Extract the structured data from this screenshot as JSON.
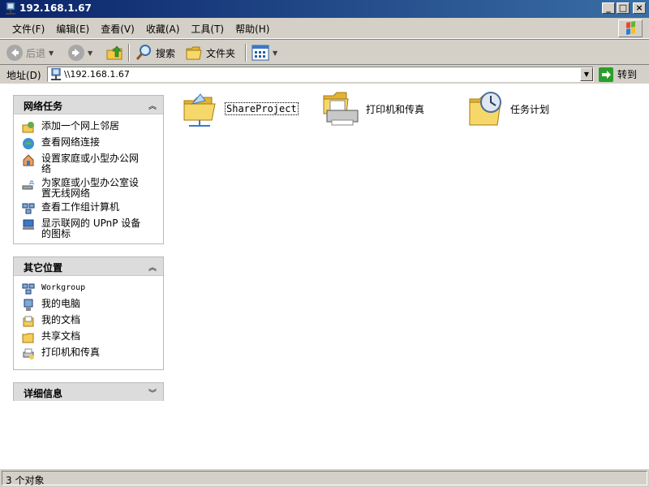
{
  "window": {
    "title": "192.168.1.67",
    "icon": "network-computer-icon"
  },
  "menu": {
    "items": [
      "文件(F)",
      "编辑(E)",
      "查看(V)",
      "收藏(A)",
      "工具(T)",
      "帮助(H)"
    ]
  },
  "toolbar": {
    "back_label": "后退",
    "search_label": "搜索",
    "folders_label": "文件夹"
  },
  "address": {
    "label": "地址(D)",
    "value": "\\\\192.168.1.67",
    "go_label": "转到"
  },
  "panels": {
    "network_tasks": {
      "title": "网络任务",
      "items": [
        {
          "label": "添加一个网上邻居",
          "icon": "add-network-place-icon"
        },
        {
          "label": "查看网络连接",
          "icon": "network-connections-icon"
        },
        {
          "label": "设置家庭或小型办公网络",
          "icon": "home-network-icon"
        },
        {
          "label": "为家庭或小型办公室设置无线网络",
          "icon": "wireless-network-icon"
        },
        {
          "label": "查看工作组计算机",
          "icon": "workgroup-computers-icon"
        },
        {
          "label": "显示联网的 UPnP 设备的图标",
          "icon": "upnp-device-icon"
        }
      ]
    },
    "other_places": {
      "title": "其它位置",
      "items": [
        {
          "label": "Workgroup",
          "icon": "workgroup-icon"
        },
        {
          "label": "我的电脑",
          "icon": "my-computer-icon"
        },
        {
          "label": "我的文档",
          "icon": "my-documents-icon"
        },
        {
          "label": "共享文档",
          "icon": "shared-documents-icon"
        },
        {
          "label": "打印机和传真",
          "icon": "printers-faxes-icon"
        }
      ]
    },
    "details": {
      "title": "详细信息"
    }
  },
  "content": {
    "items": [
      {
        "label": "ShareProject",
        "icon": "shared-folder-icon"
      },
      {
        "label": "打印机和传真",
        "icon": "printer-icon"
      },
      {
        "label": "任务计划",
        "icon": "scheduled-tasks-icon"
      }
    ]
  },
  "status": {
    "text": "3 个对象"
  },
  "colors": {
    "titlebar_start": "#0a246a",
    "titlebar_end": "#3a6ea5",
    "chrome": "#d4d0c8",
    "panel_header": "#dcdcdc"
  }
}
